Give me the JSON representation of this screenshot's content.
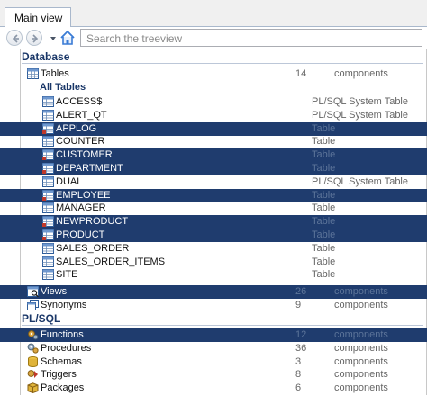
{
  "tab": {
    "label": "Main view"
  },
  "toolbar": {
    "search_placeholder": "Search the treeview"
  },
  "sections": {
    "database": "Database",
    "plsql": "PL/SQL"
  },
  "tables_row": {
    "name": "Tables",
    "count": "14",
    "unit": "components"
  },
  "all_tables": "All Tables",
  "tables": [
    {
      "name": "ACCESS$",
      "type": "PL/SQL System Table",
      "selected": false
    },
    {
      "name": "ALERT_QT",
      "type": "PL/SQL System Table",
      "selected": false
    },
    {
      "name": "APPLOG",
      "type": "Table",
      "selected": true
    },
    {
      "name": "COUNTER",
      "type": "Table",
      "selected": false
    },
    {
      "name": "CUSTOMER",
      "type": "Table",
      "selected": true
    },
    {
      "name": "DEPARTMENT",
      "type": "Table",
      "selected": true
    },
    {
      "name": "DUAL",
      "type": "PL/SQL System Table",
      "selected": false
    },
    {
      "name": "EMPLOYEE",
      "type": "Table",
      "selected": true
    },
    {
      "name": "MANAGER",
      "type": "Table",
      "selected": false
    },
    {
      "name": "NEWPRODUCT",
      "type": "Table",
      "selected": true
    },
    {
      "name": "PRODUCT",
      "type": "Table",
      "selected": true
    },
    {
      "name": "SALES_ORDER",
      "type": "Table",
      "selected": false
    },
    {
      "name": "SALES_ORDER_ITEMS",
      "type": "Table",
      "selected": false
    },
    {
      "name": "SITE",
      "type": "Table",
      "selected": false
    }
  ],
  "db_items": [
    {
      "name": "Views",
      "count": "26",
      "unit": "components",
      "selected": true
    },
    {
      "name": "Synonyms",
      "count": "9",
      "unit": "components",
      "selected": false
    }
  ],
  "plsql_items": [
    {
      "name": "Functions",
      "count": "12",
      "unit": "components",
      "selected": true
    },
    {
      "name": "Procedures",
      "count": "36",
      "unit": "components",
      "selected": false
    },
    {
      "name": "Schemas",
      "count": "3",
      "unit": "components",
      "selected": false
    },
    {
      "name": "Triggers",
      "count": "8",
      "unit": "components",
      "selected": false
    },
    {
      "name": "Packages",
      "count": "6",
      "unit": "components",
      "selected": false
    }
  ],
  "colors": {
    "selection": "#1f3c6e",
    "section_text": "#1a3768",
    "accent": "#3a7bd5"
  }
}
